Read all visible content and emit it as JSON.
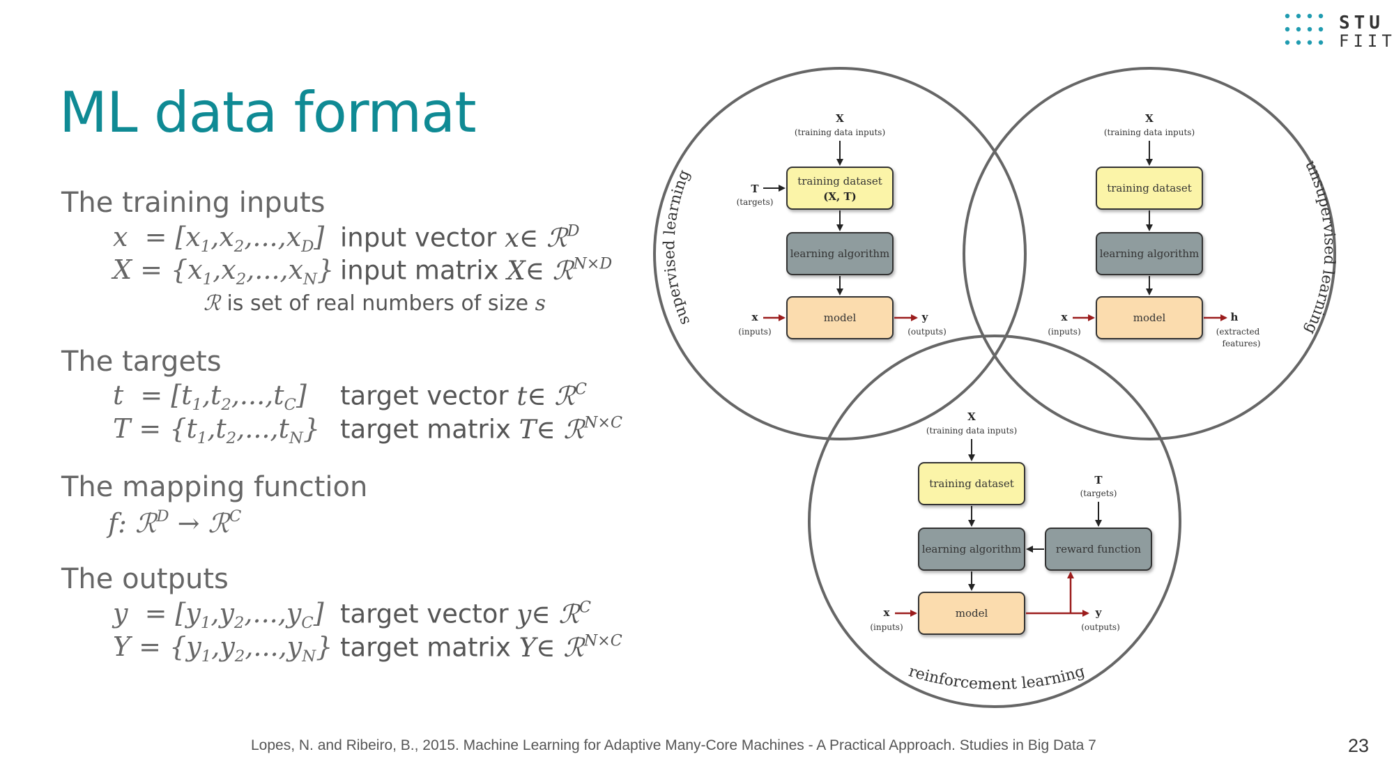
{
  "header": {
    "title": "ML data format",
    "logo_line1": "STU",
    "logo_line2": "FIIT"
  },
  "training_inputs": {
    "heading": "The training inputs",
    "vec_lhs": "x",
    "vec_eq": " = [x",
    "vec_desc": "input vector ",
    "mat_desc": "input matrix ",
    "note_text": " is set of real numbers of size "
  },
  "targets": {
    "heading": "The targets",
    "vec_desc": "target vector ",
    "mat_desc": "target matrix "
  },
  "mapping": {
    "heading": "The mapping function"
  },
  "outputs": {
    "heading": "The outputs",
    "vec_desc": "target vector ",
    "mat_desc": "target matrix "
  },
  "diagram": {
    "supervised": {
      "label": "supervised learning",
      "input_symbol": "X",
      "input_caption": "(training data inputs)",
      "target_symbol": "T",
      "target_caption": "(targets)",
      "dataset_label": "training dataset",
      "dataset_sub": "(X, T)",
      "algorithm_label": "learning algorithm",
      "model_label": "model",
      "x_symbol": "x",
      "x_caption": "(inputs)",
      "y_symbol": "y",
      "y_caption": "(outputs)"
    },
    "unsupervised": {
      "label": "unsupervised learning",
      "input_symbol": "X",
      "input_caption": "(training data inputs)",
      "dataset_label": "training dataset",
      "algorithm_label": "learning algorithm",
      "model_label": "model",
      "x_symbol": "x",
      "x_caption": "(inputs)",
      "h_symbol": "h",
      "h_caption1": "(extracted",
      "h_caption2": "features)"
    },
    "reinforcement": {
      "label": "reinforcement learning",
      "input_symbol": "X",
      "input_caption": "(training data inputs)",
      "target_symbol": "T",
      "target_caption": "(targets)",
      "dataset_label": "training dataset",
      "algorithm_label": "learning algorithm",
      "reward_label": "reward function",
      "model_label": "model",
      "x_symbol": "x",
      "x_caption": "(inputs)",
      "y_symbol": "y",
      "y_caption": "(outputs)"
    },
    "colors": {
      "dataset_fill": "#fbf4a8",
      "algorithm_fill": "#8f9c9e",
      "model_fill": "#fbdcae",
      "circle_stroke": "#666666",
      "red_arrow": "#9b1c1c"
    }
  },
  "footer": {
    "reference": "Lopes, N. and Ribeiro, B., 2015. Machine Learning for Adaptive Many-Core Machines - A Practical Approach. Studies in Big Data 7",
    "page_number": "23"
  }
}
